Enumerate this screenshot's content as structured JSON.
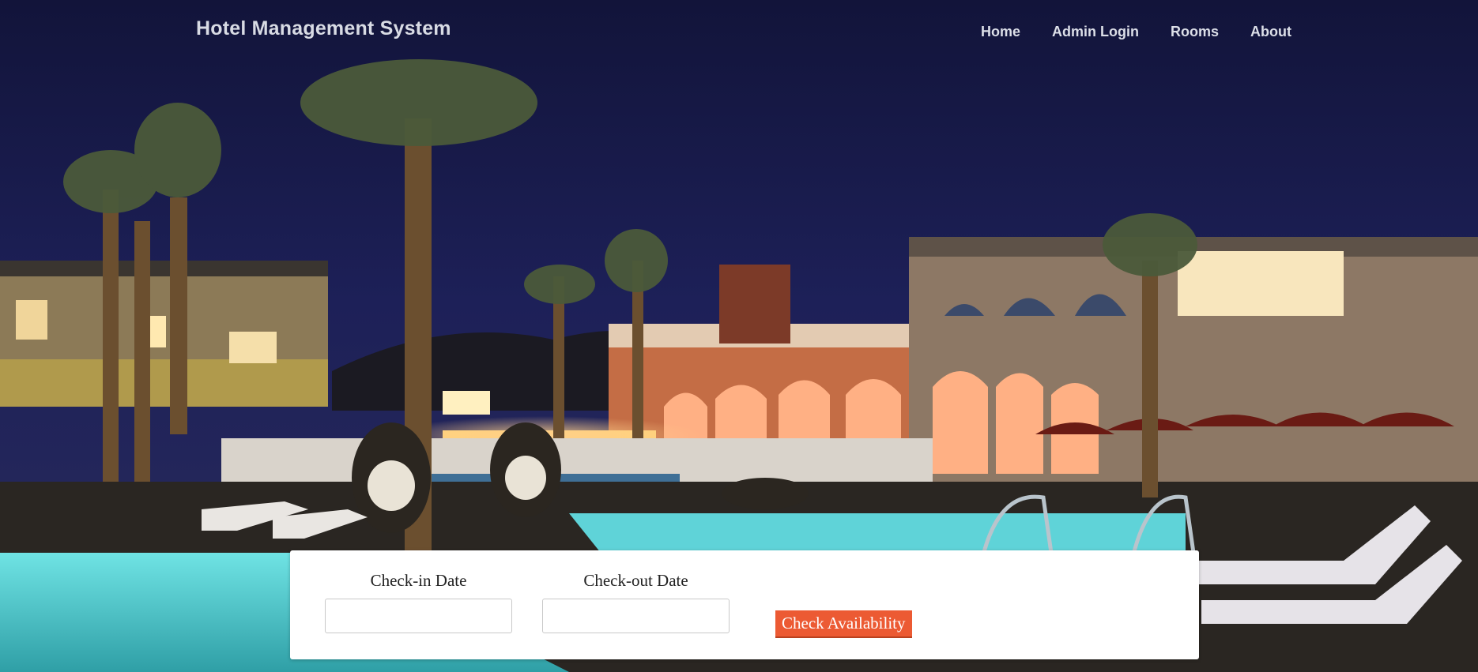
{
  "header": {
    "brand": "Hotel Management System",
    "nav": [
      "Home",
      "Admin Login",
      "Rooms",
      "About"
    ]
  },
  "search": {
    "checkin_label": "Check-in Date",
    "checkout_label": "Check-out Date",
    "checkin_value": "",
    "checkout_value": "",
    "button_label": "Check Availability"
  },
  "colors": {
    "accent": "#ec5a33",
    "sky": "#1b1d4a",
    "pool": "#4fd6da",
    "panel": "#ffffff"
  }
}
